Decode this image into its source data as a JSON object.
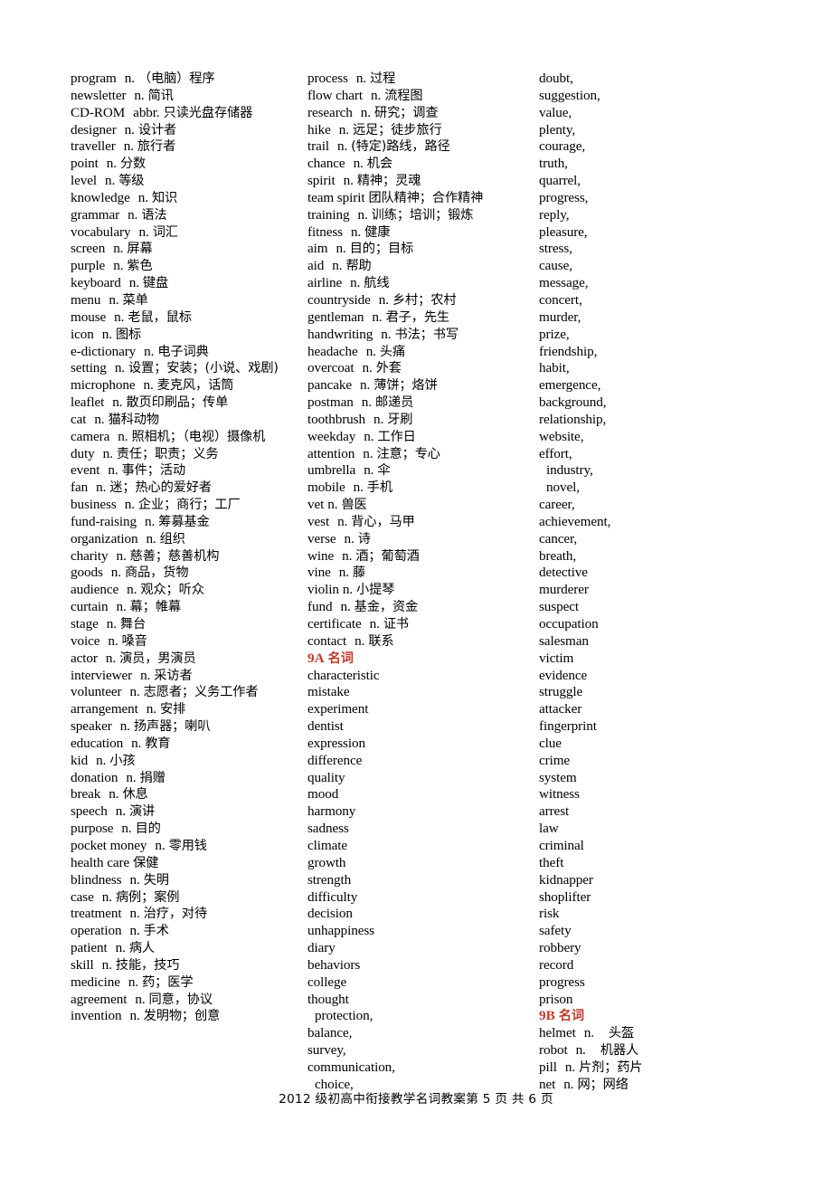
{
  "document": {
    "footer": "2012 级初高中衔接教学名词教案第 5 页  共 6 页",
    "accent_color": "#C0392B",
    "text_color": "#000000",
    "background_color": "#FFFFFF"
  },
  "columns": [
    {
      "id": "column-1",
      "entries": [
        {
          "word": "program",
          "pos": "n.",
          "meaning": "（电脑）程序"
        },
        {
          "word": "newsletter",
          "pos": "n.",
          "meaning": "简讯"
        },
        {
          "word": "CD-ROM",
          "pos": "abbr.",
          "meaning": "只读光盘存储器"
        },
        {
          "word": "designer",
          "pos": "n.",
          "meaning": "设计者"
        },
        {
          "word": "traveller",
          "pos": "n.",
          "meaning": "旅行者"
        },
        {
          "word": "point",
          "pos": "n.",
          "meaning": "分数"
        },
        {
          "word": "level",
          "pos": "n.",
          "meaning": "等级"
        },
        {
          "word": "knowledge",
          "pos": "n.",
          "meaning": "知识"
        },
        {
          "word": "grammar",
          "pos": "n.",
          "meaning": "语法"
        },
        {
          "word": "vocabulary",
          "pos": "n.",
          "meaning": "词汇"
        },
        {
          "word": "screen",
          "pos": "n.",
          "meaning": "屏幕"
        },
        {
          "word": "purple",
          "pos": "n.",
          "meaning": "紫色"
        },
        {
          "word": "keyboard",
          "pos": "n.",
          "meaning": "键盘"
        },
        {
          "word": "menu",
          "pos": "n.",
          "meaning": "菜单"
        },
        {
          "word": "mouse",
          "pos": "n.",
          "meaning": "老鼠，鼠标"
        },
        {
          "word": "icon",
          "pos": "n.",
          "meaning": "图标"
        },
        {
          "word": "e-dictionary",
          "pos": "n.",
          "meaning": "电子词典"
        },
        {
          "word": "setting",
          "pos": "n.",
          "meaning": "设置；安装；(小说、戏剧)"
        },
        {
          "word": "microphone",
          "pos": "n.",
          "meaning": "麦克风，话筒"
        },
        {
          "word": "leaflet",
          "pos": "n.",
          "meaning": "散页印刷品；传单"
        },
        {
          "word": "cat",
          "pos": "n.",
          "meaning": "猫科动物"
        },
        {
          "word": "camera",
          "pos": "n.",
          "meaning": "照相机；（电视）摄像机"
        },
        {
          "word": "duty",
          "pos": "n.",
          "meaning": "责任；职责；义务"
        },
        {
          "word": "event",
          "pos": "n.",
          "meaning": "事件；活动"
        },
        {
          "word": "fan",
          "pos": "n.",
          "meaning": "迷；热心的爱好者"
        },
        {
          "word": "business",
          "pos": "n.",
          "meaning": "企业；商行；工厂"
        },
        {
          "word": "fund-raising",
          "pos": "n.",
          "meaning": "筹募基金"
        },
        {
          "word": "organization",
          "pos": "n.",
          "meaning": "组织"
        },
        {
          "word": "charity",
          "pos": "n.",
          "meaning": "慈善；慈善机构"
        },
        {
          "word": "goods",
          "pos": "n.",
          "meaning": "商品，货物"
        },
        {
          "word": "audience",
          "pos": "n.",
          "meaning": "观众；听众"
        },
        {
          "word": "curtain",
          "pos": "n.",
          "meaning": "幕；帷幕"
        },
        {
          "word": "stage",
          "pos": "n.",
          "meaning": "舞台"
        },
        {
          "word": "voice",
          "pos": "n.",
          "meaning": "嗓音"
        },
        {
          "word": "actor",
          "pos": "n.",
          "meaning": "演员，男演员"
        },
        {
          "word": "interviewer",
          "pos": "n.",
          "meaning": "采访者"
        },
        {
          "word": "volunteer",
          "pos": "n.",
          "meaning": "志愿者；义务工作者"
        },
        {
          "word": "arrangement",
          "pos": "n.",
          "meaning": "安排"
        },
        {
          "word": "speaker",
          "pos": "n.",
          "meaning": "扬声器；喇叭"
        },
        {
          "word": "education",
          "pos": "n.",
          "meaning": "教育"
        },
        {
          "word": "kid",
          "pos": "n.",
          "meaning": "小孩"
        },
        {
          "word": "donation",
          "pos": "n.",
          "meaning": "捐赠"
        },
        {
          "word": "break",
          "pos": "n.",
          "meaning": "休息"
        },
        {
          "word": "speech",
          "pos": "n.",
          "meaning": "演讲"
        },
        {
          "word": "purpose",
          "pos": "n.",
          "meaning": "目的"
        },
        {
          "word": "pocket money",
          "pos": "n.",
          "meaning": "零用钱"
        },
        {
          "word": "health care",
          "pos": "",
          "meaning": "保健"
        },
        {
          "word": "blindness",
          "pos": "n.",
          "meaning": "失明"
        },
        {
          "word": "case",
          "pos": "n.",
          "meaning": "病例；案例"
        },
        {
          "word": "treatment",
          "pos": "n.",
          "meaning": "治疗，对待"
        },
        {
          "word": "operation",
          "pos": "n.",
          "meaning": "手术"
        },
        {
          "word": "patient",
          "pos": "n.",
          "meaning": "病人"
        },
        {
          "word": "skill",
          "pos": "n.",
          "meaning": "技能，技巧"
        },
        {
          "word": "medicine",
          "pos": "n.",
          "meaning": "药；医学"
        },
        {
          "word": "agreement",
          "pos": "n.",
          "meaning": "同意，协议"
        },
        {
          "word": "invention",
          "pos": "n.",
          "meaning": "发明物；创意"
        }
      ]
    },
    {
      "id": "column-2",
      "entries": [
        {
          "word": "process",
          "pos": "n.",
          "meaning": "过程"
        },
        {
          "word": "flow chart",
          "pos": "n.",
          "meaning": "流程图"
        },
        {
          "word": "research",
          "pos": "n.",
          "meaning": "研究；调查"
        },
        {
          "word": "hike",
          "pos": "n.",
          "meaning": "远足；徒步旅行"
        },
        {
          "word": "trail",
          "pos": "n.",
          "meaning": "(特定)路线，路径"
        },
        {
          "word": "chance",
          "pos": "n.",
          "meaning": "机会"
        },
        {
          "word": "spirit",
          "pos": "n.",
          "meaning": "精神；灵魂"
        },
        {
          "word": "team spirit",
          "pos": "",
          "meaning": "团队精神；合作精神"
        },
        {
          "word": "training",
          "pos": "n.",
          "meaning": "训练；培训；锻炼"
        },
        {
          "word": "fitness",
          "pos": "n.",
          "meaning": "健康"
        },
        {
          "word": "aim",
          "pos": "n.",
          "meaning": "目的；目标"
        },
        {
          "word": "aid",
          "pos": "n.",
          "meaning": "帮助"
        },
        {
          "word": "airline",
          "pos": "n.",
          "meaning": "航线"
        },
        {
          "word": "countryside",
          "pos": "n.",
          "meaning": "乡村；农村"
        },
        {
          "word": "gentleman",
          "pos": "n.",
          "meaning": "君子，先生"
        },
        {
          "word": "handwriting",
          "pos": "n.",
          "meaning": "书法；书写"
        },
        {
          "word": "headache",
          "pos": "n.",
          "meaning": "头痛"
        },
        {
          "word": "overcoat",
          "pos": "n.",
          "meaning": "外套"
        },
        {
          "word": "pancake",
          "pos": "n.",
          "meaning": "薄饼；烙饼"
        },
        {
          "word": "postman",
          "pos": "n.",
          "meaning": "邮递员"
        },
        {
          "word": "toothbrush",
          "pos": "n.",
          "meaning": "牙刷"
        },
        {
          "word": "weekday",
          "pos": "n.",
          "meaning": "工作日"
        },
        {
          "word": "attention",
          "pos": "n.",
          "meaning": "注意；专心"
        },
        {
          "word": "umbrella",
          "pos": "n.",
          "meaning": "伞"
        },
        {
          "word": "mobile",
          "pos": "n.",
          "meaning": "手机"
        },
        {
          "word": "vet",
          "pos": "n.",
          "meaning": "兽医",
          "tight": true
        },
        {
          "word": "vest",
          "pos": "n.",
          "meaning": "背心，马甲"
        },
        {
          "word": "verse",
          "pos": "n.",
          "meaning": "诗"
        },
        {
          "word": "wine",
          "pos": "n.",
          "meaning": "酒；葡萄酒"
        },
        {
          "word": "vine",
          "pos": "n.",
          "meaning": "藤"
        },
        {
          "word": "violin",
          "pos": "n.",
          "meaning": "小提琴",
          "tight": true
        },
        {
          "word": "fund",
          "pos": "n.",
          "meaning": "基金，资金"
        },
        {
          "word": "certificate",
          "pos": "n.",
          "meaning": "证书"
        },
        {
          "word": "contact",
          "pos": "n.",
          "meaning": "联系"
        }
      ],
      "section": {
        "label_en": "9A",
        "label_cn": "名词"
      },
      "plain_entries": [
        "characteristic",
        "mistake",
        "experiment",
        "dentist",
        "expression",
        "difference",
        "quality",
        "mood",
        "harmony",
        "sadness",
        "climate",
        "growth",
        "strength",
        "difficulty",
        "decision",
        "unhappiness",
        "diary",
        "behaviors",
        "college",
        "thought",
        "protection,",
        "balance,",
        "survey,",
        "communication,",
        "choice,"
      ],
      "plain_indented": [
        "protection,",
        "choice,"
      ]
    },
    {
      "id": "column-3",
      "plain_entries_top": [
        "doubt,",
        "suggestion,",
        "value,",
        "plenty,",
        "courage,",
        "truth,",
        "quarrel,",
        "progress,",
        "reply,",
        "pleasure,",
        "stress,",
        "cause,",
        "message,",
        "concert,",
        "murder,",
        "prize,",
        "friendship,",
        "habit,",
        "emergence,",
        "background,",
        "relationship,",
        "website,",
        "effort,",
        "industry,",
        "novel,",
        "career,",
        "achievement,",
        "cancer,",
        "breath,",
        "detective",
        "murderer",
        "suspect",
        "occupation",
        "salesman",
        "victim",
        "evidence",
        "struggle",
        "attacker",
        "fingerprint",
        "clue",
        "crime",
        "system",
        "witness",
        "arrest",
        "law",
        "criminal",
        "theft",
        "kidnapper",
        "shoplifter",
        "risk",
        "safety",
        "robbery",
        "record",
        "progress",
        "prison"
      ],
      "plain_indented": [
        "industry,",
        "novel,"
      ],
      "section": {
        "label_en": "9B",
        "label_cn": "名词"
      },
      "entries_bottom": [
        {
          "word": "helmet",
          "pos": "n.",
          "meaning": "头盔",
          "wide": true
        },
        {
          "word": "robot",
          "pos": "n.",
          "meaning": "机器人",
          "wide": true
        },
        {
          "word": "pill",
          "pos": "n.",
          "meaning": "片剂；药片"
        },
        {
          "word": "net",
          "pos": "n.",
          "meaning": "网；网络"
        }
      ]
    }
  ]
}
